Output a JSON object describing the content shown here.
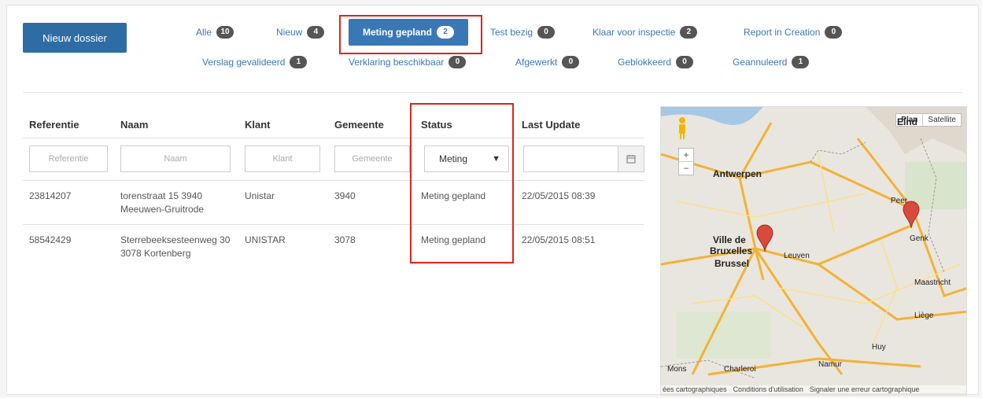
{
  "toolbar": {
    "new_dossier": "Nieuw dossier"
  },
  "filters": [
    {
      "label": "Alle",
      "count": "10"
    },
    {
      "label": "Nieuw",
      "count": "4"
    },
    {
      "label": "Meting gepland",
      "count": "2"
    },
    {
      "label": "Test bezig",
      "count": "0"
    },
    {
      "label": "Klaar voor inspectie",
      "count": "2"
    },
    {
      "label": "Report in Creation",
      "count": "0"
    },
    {
      "label": "Verslag gevalideerd",
      "count": "1"
    },
    {
      "label": "Verklaring beschikbaar",
      "count": "0"
    },
    {
      "label": "Afgewerkt",
      "count": "0"
    },
    {
      "label": "Geblokkeerd",
      "count": "0"
    },
    {
      "label": "Geannuleerd",
      "count": "1"
    }
  ],
  "table": {
    "headers": [
      "Referentie",
      "Naam",
      "Klant",
      "Gemeente",
      "Status",
      "Last Update"
    ],
    "placeholders": {
      "referentie": "Referentie",
      "naam": "Naam",
      "klant": "Klant",
      "gemeente": "Gemeente"
    },
    "status_filter": "Meting",
    "rows": [
      {
        "ref": "23814207",
        "naam": "torenstraat 15 3940 Meeuwen-Gruitrode",
        "klant": "Unistar",
        "gemeente": "3940",
        "status": "Meting gepland",
        "update": "22/05/2015 08:39"
      },
      {
        "ref": "58542429",
        "naam": "Sterrebeeksesteenweg 30 3078 Kortenberg",
        "klant": "UNISTAR",
        "gemeente": "3078",
        "status": "Meting gepland",
        "update": "22/05/2015 08:51"
      }
    ]
  },
  "map": {
    "type_plan": "Plan",
    "type_sat": "Satellite",
    "zoom_in": "+",
    "zoom_out": "−",
    "cities": {
      "antwerpen": "Antwerpen",
      "bruxelles1": "Ville de",
      "bruxelles2": "Bruxelles",
      "brussel": "Brussel",
      "leuven": "Leuven",
      "genk": "Genk",
      "maastricht": "Maastricht",
      "liege": "Liège",
      "huy": "Huy",
      "namur": "Namur",
      "charleroi": "Charleroi",
      "mons": "Mons",
      "eind": "Eind",
      "peer": "Peer"
    },
    "footer": [
      "ées cartographiques",
      "Conditions d'utilisation",
      "Signaler une erreur cartographique"
    ]
  },
  "colors": {
    "primary": "#2e6da4",
    "link": "#3a78b5",
    "highlight": "#d9261c"
  }
}
